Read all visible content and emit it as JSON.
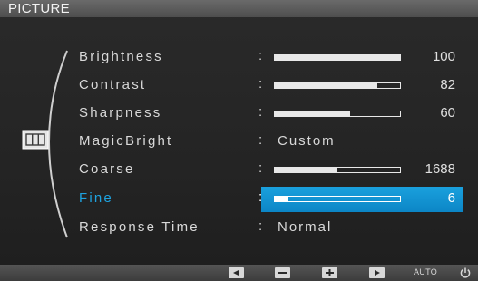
{
  "window": {
    "title": "PICTURE"
  },
  "menu": {
    "items": [
      {
        "label": "Brightness",
        "value": 100,
        "max": 100,
        "type": "bar"
      },
      {
        "label": "Contrast",
        "value": 82,
        "max": 100,
        "type": "bar"
      },
      {
        "label": "Sharpness",
        "value": 60,
        "max": 100,
        "type": "bar"
      },
      {
        "label": "MagicBright",
        "value": "Custom",
        "type": "text"
      },
      {
        "label": "Coarse",
        "value": 1688,
        "bar_fraction": 0.5,
        "type": "bar"
      },
      {
        "label": "Fine",
        "value": 6,
        "bar_fraction": 0.1,
        "type": "bar",
        "selected": true
      },
      {
        "label": "Response Time",
        "value": "Normal",
        "type": "text"
      }
    ],
    "colon": ":"
  },
  "footer": {
    "buttons": [
      {
        "icon": "left-arrow-icon"
      },
      {
        "icon": "minus-icon"
      },
      {
        "icon": "plus-icon"
      },
      {
        "icon": "right-arrow-icon"
      }
    ],
    "auto_label": "AUTO",
    "power_icon": "power-icon"
  },
  "colors": {
    "accent": "#0c86c6",
    "selected_label": "#1ea3e0",
    "text": "#d9d9d9",
    "background": "#262626"
  }
}
